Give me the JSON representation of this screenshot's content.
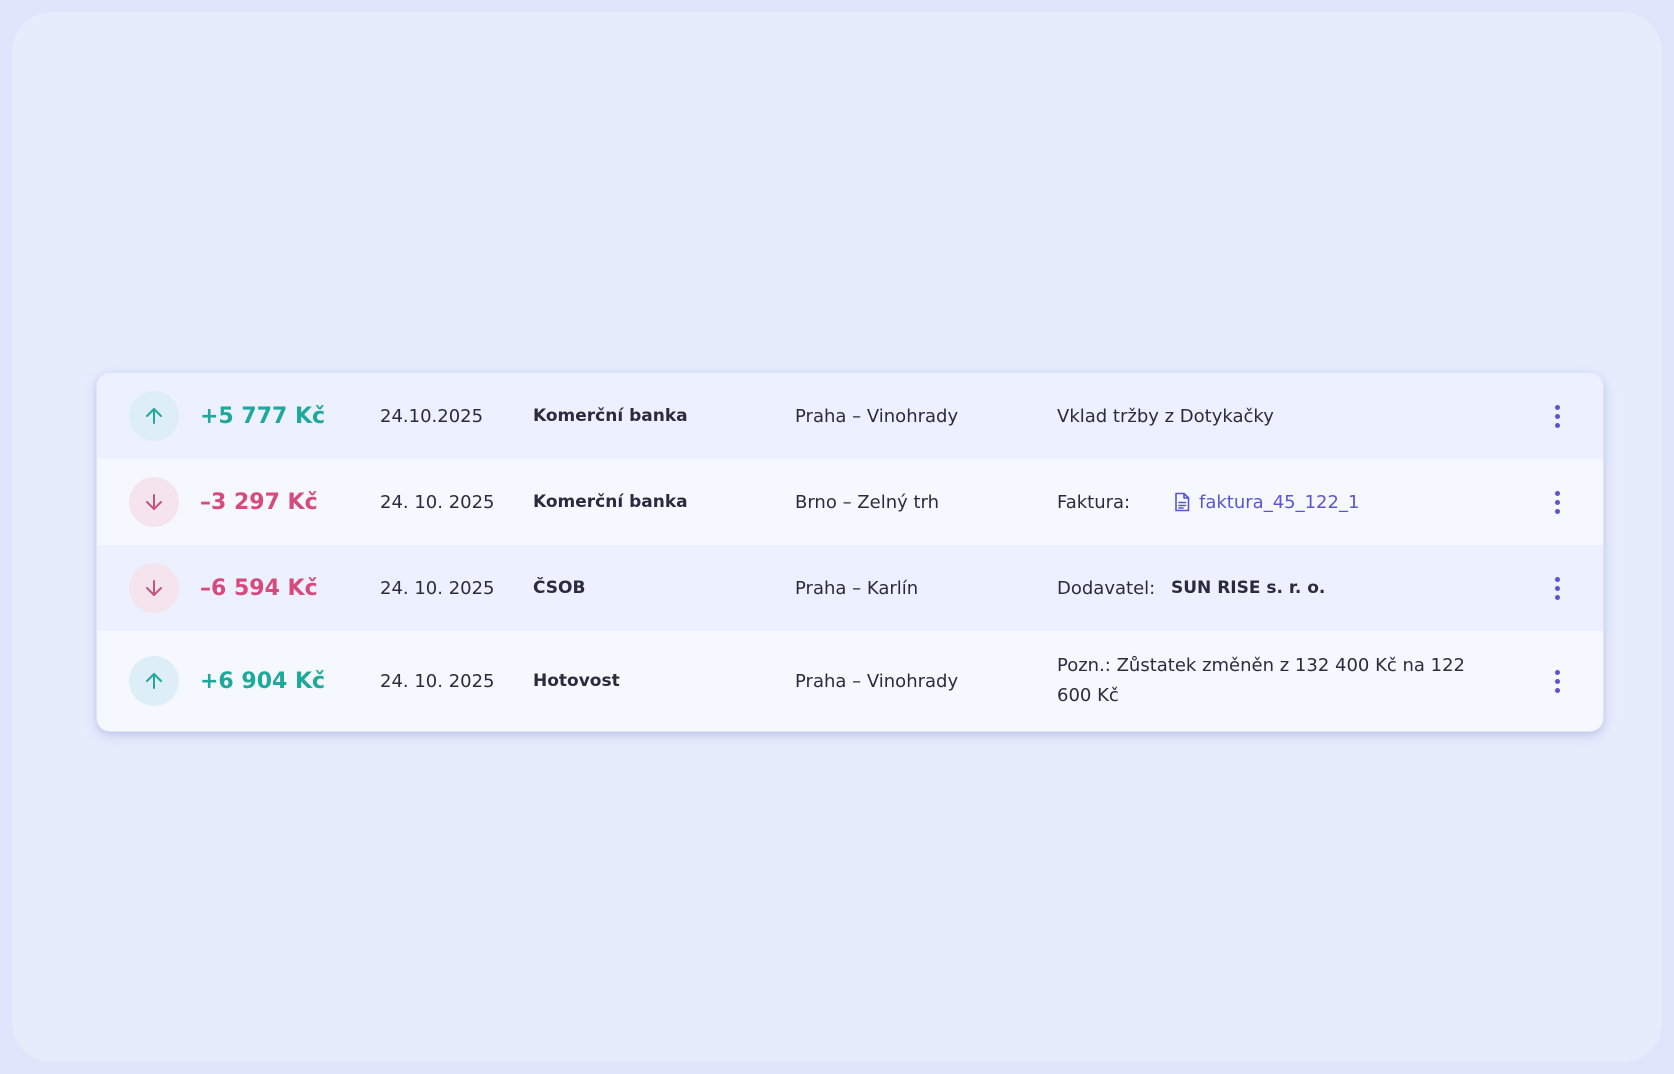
{
  "colors": {
    "positive": "#1fa99c",
    "negative": "#d64b7c",
    "link": "#5b55d1",
    "background": "#e7ecfd"
  },
  "transactions": [
    {
      "direction_icon": "arrow-up-icon",
      "amount": "+5 777 Kč",
      "date": "24.10.2025",
      "bank": "Komerční banka",
      "branch": "Praha – Vinohrady",
      "note": "Vklad tržby z Dotykačky",
      "action_icon": "more-vertical-icon"
    },
    {
      "direction_icon": "arrow-down-icon",
      "amount": "–3 297 Kč",
      "date": "24. 10. 2025",
      "bank": "Komerční banka",
      "branch": "Brno – Zelný trh",
      "note_label": "Faktura:",
      "file_icon": "file-icon",
      "file_name": "faktura_45_122_1",
      "action_icon": "more-vertical-icon"
    },
    {
      "direction_icon": "arrow-down-icon",
      "amount": "–6 594 Kč",
      "date": "24. 10. 2025",
      "bank": "ČSOB",
      "branch": "Praha – Karlín",
      "note_label": "Dodavatel:",
      "supplier": "SUN RISE s. r. o.",
      "action_icon": "more-vertical-icon"
    },
    {
      "direction_icon": "arrow-up-icon",
      "amount": "+6 904 Kč",
      "date": "24. 10. 2025",
      "bank": "Hotovost",
      "branch": "Praha – Vinohrady",
      "note": "Pozn.: Zůstatek změněn z 132 400 Kč na 122 600 Kč",
      "action_icon": "more-vertical-icon"
    }
  ]
}
